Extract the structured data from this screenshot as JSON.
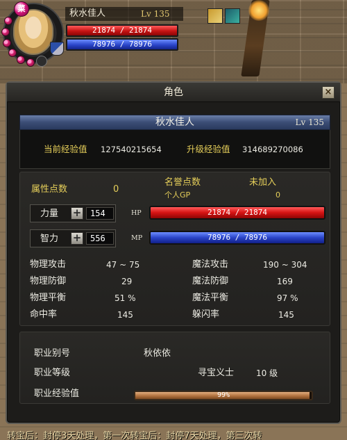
{
  "hud": {
    "name": "秋水佳人",
    "level": "Lv 135",
    "hp": "21874 / 21874",
    "mp": "78976 / 78976"
  },
  "window": {
    "title": "角色",
    "close_label": "×"
  },
  "character": {
    "name": "秋水佳人",
    "level": "Lv 135"
  },
  "experience": {
    "current_label": "当前经验值",
    "current_value": "127540215654",
    "next_label": "升级经验值",
    "next_value": "314689270086"
  },
  "attributes": {
    "points_label": "属性点数",
    "points_value": "0",
    "honor_label": "名誉点数",
    "honor_status": "未加入",
    "gp_label": "个人GP",
    "gp_value": "0",
    "strength_label": "力量",
    "strength_value": "154",
    "intellect_label": "智力",
    "intellect_value": "556",
    "plus_label": "+",
    "hp_tag": "HP",
    "mp_tag": "MP",
    "hp": "21874 / 21874",
    "mp": "78976 / 78976"
  },
  "combat": {
    "left": [
      {
        "label": "物理攻击",
        "value": "47 ~ 75"
      },
      {
        "label": "物理防御",
        "value": "29"
      },
      {
        "label": "物理平衡",
        "value": "51 %"
      },
      {
        "label": "命中率",
        "value": "145"
      }
    ],
    "right": [
      {
        "label": "魔法攻击",
        "value": "190 ~ 304"
      },
      {
        "label": "魔法防御",
        "value": "169"
      },
      {
        "label": "魔法平衡",
        "value": "97 %"
      },
      {
        "label": "躲闪率",
        "value": "145"
      }
    ]
  },
  "job": {
    "alias_label": "职业别号",
    "alias_value": "秋依依",
    "grade_label": "职业等级",
    "grade_title": "寻宝义士",
    "grade_value": "10 级",
    "exp_label": "职业经验值",
    "exp_text": "99%",
    "exp_fraction": 0.99
  },
  "footer": {
    "text": "转宝后：封停3天处理，第一次转宝后：封停7天处理，第三次转"
  },
  "colors": {
    "label_yellow": "#e6cf5a",
    "label_green": "#9fe07a",
    "hp_red": "#d61313",
    "mp_blue": "#2a44c8",
    "job_exp_bar": "#b27240"
  }
}
